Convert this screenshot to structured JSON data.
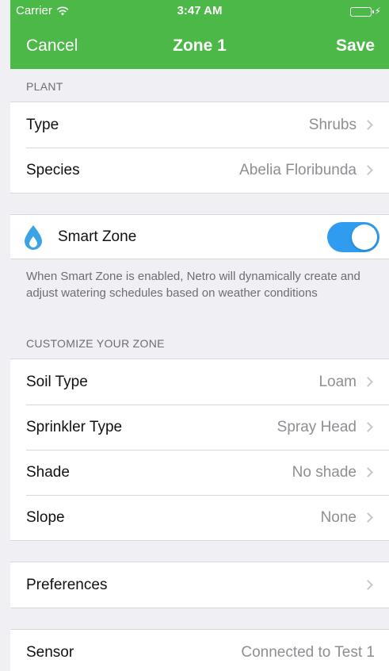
{
  "status_bar": {
    "carrier": "Carrier",
    "time": "3:47 AM"
  },
  "nav": {
    "cancel_label": "Cancel",
    "title": "Zone 1",
    "save_label": "Save"
  },
  "plant": {
    "header": "PLANT",
    "rows": [
      {
        "label": "Type",
        "value": "Shrubs"
      },
      {
        "label": "Species",
        "value": "Abelia Floribunda"
      }
    ]
  },
  "smart_zone": {
    "label": "Smart Zone",
    "enabled": true,
    "description": "When Smart Zone is enabled, Netro will dynamically create and adjust watering schedules based on weather conditions"
  },
  "customize": {
    "header": "CUSTOMIZE YOUR ZONE",
    "rows": [
      {
        "label": "Soil Type",
        "value": "Loam"
      },
      {
        "label": "Sprinkler Type",
        "value": "Spray Head"
      },
      {
        "label": "Shade",
        "value": "No shade"
      },
      {
        "label": "Slope",
        "value": "None"
      }
    ]
  },
  "preferences": {
    "label": "Preferences"
  },
  "sensor": {
    "label": "Sensor",
    "value": "Connected to Test 1"
  },
  "colors": {
    "nav_green": "#4cb847",
    "toggle_blue": "#2f9cf0",
    "drop_blue": "#3aa3e6"
  }
}
